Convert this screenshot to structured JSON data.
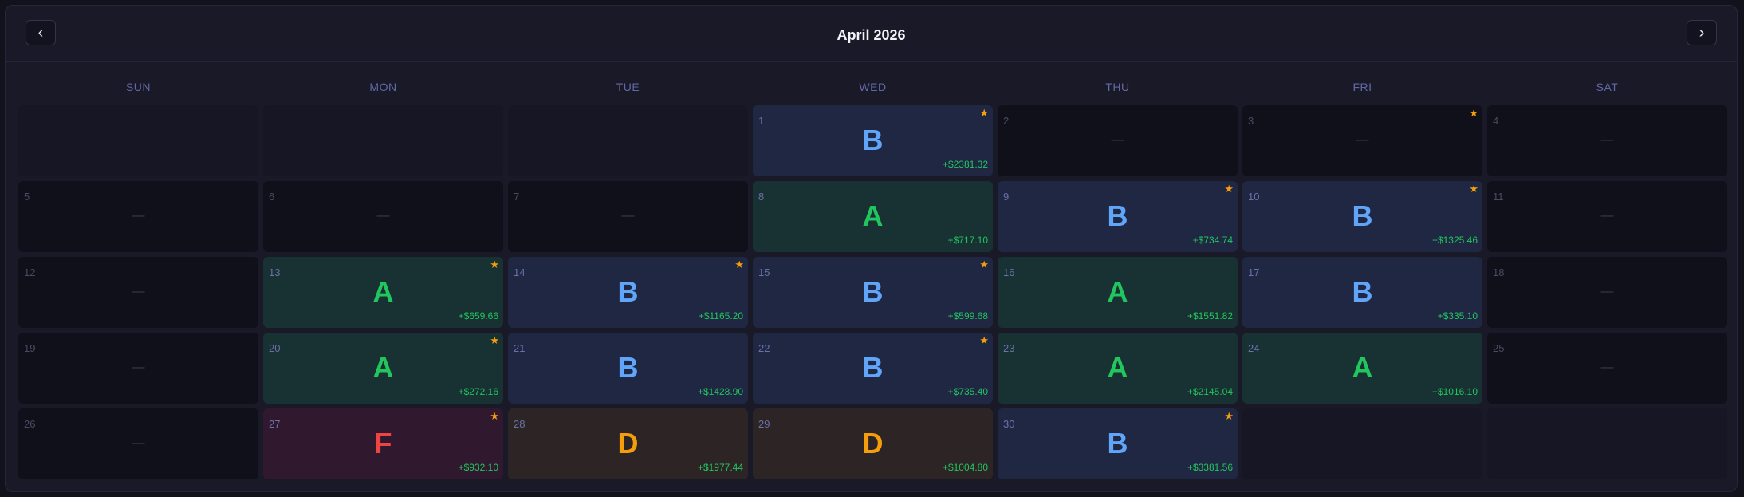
{
  "header": {
    "title": "April 2026",
    "prev_icon": "‹",
    "next_icon": "›"
  },
  "weekdays": [
    "SUN",
    "MON",
    "TUE",
    "WED",
    "THU",
    "FRI",
    "SAT"
  ],
  "colors": {
    "grade_A": "#22c55e",
    "grade_B": "#60a5fa",
    "grade_D": "#f59e0b",
    "grade_F": "#ef4444",
    "star": "#f59e0b",
    "pnl": "#22c55e"
  },
  "empty_placeholder": "—",
  "star_icon": "★",
  "weeks": [
    [
      {
        "empty": true
      },
      {
        "empty": true
      },
      {
        "empty": true
      },
      {
        "day": "1",
        "grade": "B",
        "pnl": "+$2381.32",
        "star": true
      },
      {
        "day": "2",
        "grade": null,
        "pnl": null,
        "star": false
      },
      {
        "day": "3",
        "grade": null,
        "pnl": null,
        "star": true
      },
      {
        "day": "4",
        "grade": null,
        "pnl": null,
        "star": false
      }
    ],
    [
      {
        "day": "5",
        "grade": null,
        "pnl": null,
        "star": false
      },
      {
        "day": "6",
        "grade": null,
        "pnl": null,
        "star": false
      },
      {
        "day": "7",
        "grade": null,
        "pnl": null,
        "star": false
      },
      {
        "day": "8",
        "grade": "A",
        "pnl": "+$717.10",
        "star": false
      },
      {
        "day": "9",
        "grade": "B",
        "pnl": "+$734.74",
        "star": true
      },
      {
        "day": "10",
        "grade": "B",
        "pnl": "+$1325.46",
        "star": true
      },
      {
        "day": "11",
        "grade": null,
        "pnl": null,
        "star": false
      }
    ],
    [
      {
        "day": "12",
        "grade": null,
        "pnl": null,
        "star": false
      },
      {
        "day": "13",
        "grade": "A",
        "pnl": "+$659.66",
        "star": true
      },
      {
        "day": "14",
        "grade": "B",
        "pnl": "+$1165.20",
        "star": true
      },
      {
        "day": "15",
        "grade": "B",
        "pnl": "+$599.68",
        "star": true
      },
      {
        "day": "16",
        "grade": "A",
        "pnl": "+$1551.82",
        "star": false
      },
      {
        "day": "17",
        "grade": "B",
        "pnl": "+$335.10",
        "star": false
      },
      {
        "day": "18",
        "grade": null,
        "pnl": null,
        "star": false
      }
    ],
    [
      {
        "day": "19",
        "grade": null,
        "pnl": null,
        "star": false
      },
      {
        "day": "20",
        "grade": "A",
        "pnl": "+$272.16",
        "star": true
      },
      {
        "day": "21",
        "grade": "B",
        "pnl": "+$1428.90",
        "star": false
      },
      {
        "day": "22",
        "grade": "B",
        "pnl": "+$735.40",
        "star": true
      },
      {
        "day": "23",
        "grade": "A",
        "pnl": "+$2145.04",
        "star": false
      },
      {
        "day": "24",
        "grade": "A",
        "pnl": "+$1016.10",
        "star": false
      },
      {
        "day": "25",
        "grade": null,
        "pnl": null,
        "star": false
      }
    ],
    [
      {
        "day": "26",
        "grade": null,
        "pnl": null,
        "star": false
      },
      {
        "day": "27",
        "grade": "F",
        "pnl": "+$932.10",
        "star": true
      },
      {
        "day": "28",
        "grade": "D",
        "pnl": "+$1977.44",
        "star": false
      },
      {
        "day": "29",
        "grade": "D",
        "pnl": "+$1004.80",
        "star": false
      },
      {
        "day": "30",
        "grade": "B",
        "pnl": "+$3381.56",
        "star": true
      },
      {
        "empty": true
      },
      {
        "empty": true
      }
    ]
  ]
}
